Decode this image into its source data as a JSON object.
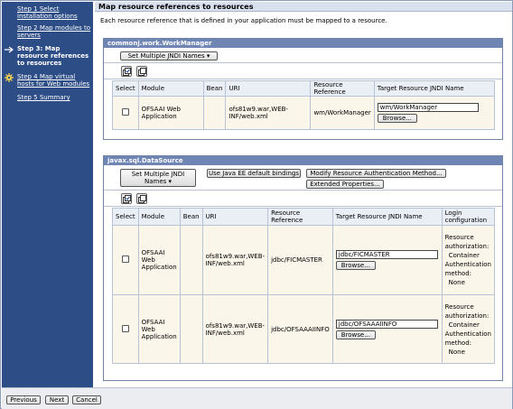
{
  "sidebar": {
    "steps": [
      {
        "label": "Step 1 Select installation options",
        "state": "link"
      },
      {
        "label": "Step 2 Map modules to servers",
        "state": "link"
      },
      {
        "label": "Step 3: Map resource references to resources",
        "state": "current"
      },
      {
        "label": "Step 4 Map virtual hosts for Web modules",
        "state": "link"
      },
      {
        "label": "Step 5 Summary",
        "state": "link"
      }
    ],
    "current_marker_icon": "arrow-right-icon",
    "step4_icon": "gear-icon"
  },
  "main": {
    "title": "Map resource references to resources",
    "intro": "Each resource reference that is defined in your application must be mapped to a resource."
  },
  "workmanager": {
    "header": "commonj.work.WorkManager",
    "set_jndi_button": "Set Multiple JNDI Names",
    "columns": [
      "Select",
      "Module",
      "Bean",
      "URI",
      "Resource Reference",
      "Target Resource JNDI Name"
    ],
    "rows": [
      {
        "module": "OFSAAI Web Application",
        "bean": "",
        "uri": "ofs81w9.war,WEB-INF/web.xml",
        "reference": "wm/WorkManager",
        "jndi": "wm/WorkManager",
        "browse": "Browse..."
      }
    ]
  },
  "datasource": {
    "header": "javax.sql.DataSource",
    "set_jndi_button": "Set Multiple JNDI Names",
    "java_ee_button": "Use Java EE default bindings",
    "modify_auth_button": "Modify Resource Authentication Method...",
    "extended_props_button": "Extended Properties...",
    "columns": [
      "Select",
      "Module",
      "Bean",
      "URI",
      "Resource Reference",
      "Target Resource JNDI Name",
      "Login configuration"
    ],
    "rows": [
      {
        "module": "OFSAAI Web Application",
        "bean": "",
        "uri": "ofs81w9.war,WEB-INF/web.xml",
        "reference": "jdbc/FICMASTER",
        "jndi": "jdbc/FICMASTER",
        "browse": "Browse...",
        "login_auth_label": "Resource authorization:",
        "login_auth_value": "Container",
        "login_method_label": "Authentication method:",
        "login_method_value": "None"
      },
      {
        "module": "OFSAAI Web Application",
        "bean": "",
        "uri": "ofs81w9.war,WEB-INF/web.xml",
        "reference": "jdbc/OFSAAAIINFO",
        "jndi": "jdbc/OFSAAAIINFO",
        "browse": "Browse...",
        "login_auth_label": "Resource authorization:",
        "login_auth_value": "Container",
        "login_method_label": "Authentication method:",
        "login_method_value": "None"
      }
    ]
  },
  "footer": {
    "previous": "Previous",
    "next": "Next",
    "cancel": "Cancel"
  },
  "colors": {
    "sidebar_bg": "#2d4d86",
    "section_header_bg": "#6f86b4",
    "row_bg": "#fbf6ea"
  }
}
